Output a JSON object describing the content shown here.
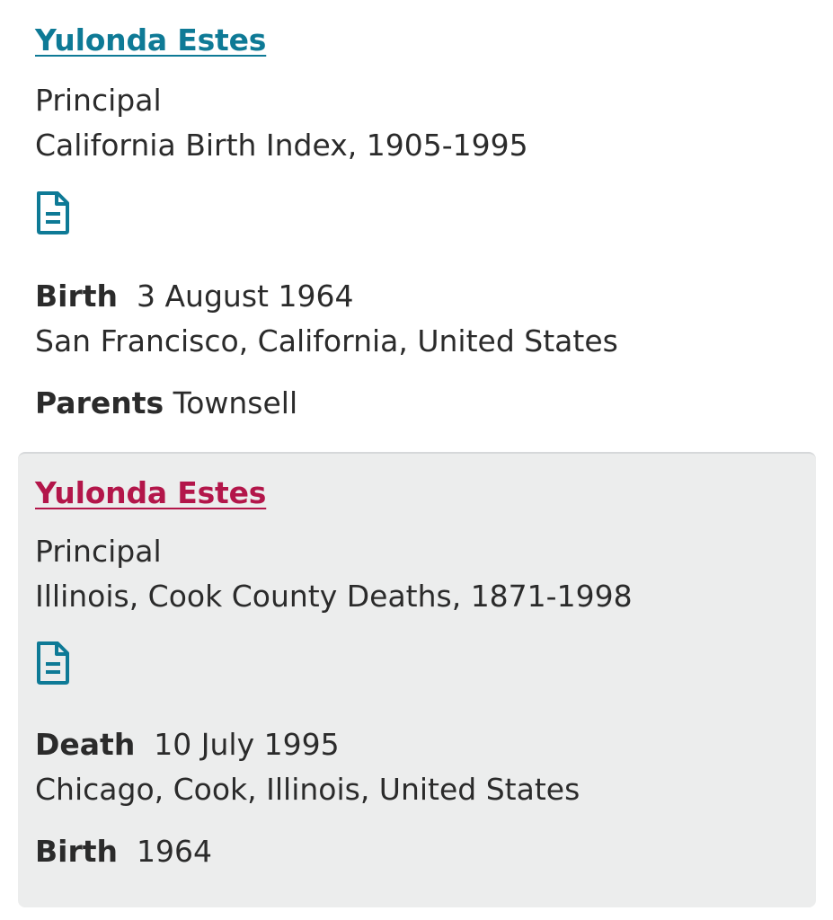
{
  "records": [
    {
      "name": "Yulonda Estes",
      "role": "Principal",
      "collection": "California Birth Index, 1905-1995",
      "icon": "document-icon",
      "event1": {
        "label": "Birth",
        "date": "3 August 1964",
        "place": "San Francisco, California, United States"
      },
      "event2": {
        "label": "Parents",
        "value": "Townsell"
      }
    },
    {
      "name": "Yulonda Estes",
      "role": "Principal",
      "collection": "Illinois, Cook County Deaths, 1871-1998",
      "icon": "document-icon",
      "event1": {
        "label": "Death",
        "date": "10 July 1995",
        "place": "Chicago, Cook, Illinois, United States"
      },
      "event2": {
        "label": "Birth",
        "value": "1964"
      }
    }
  ],
  "colors": {
    "link_blue": "#0e7a96",
    "link_visited": "#b3164a",
    "card_highlight_bg": "#eceded",
    "icon_color": "#0e7a96"
  }
}
